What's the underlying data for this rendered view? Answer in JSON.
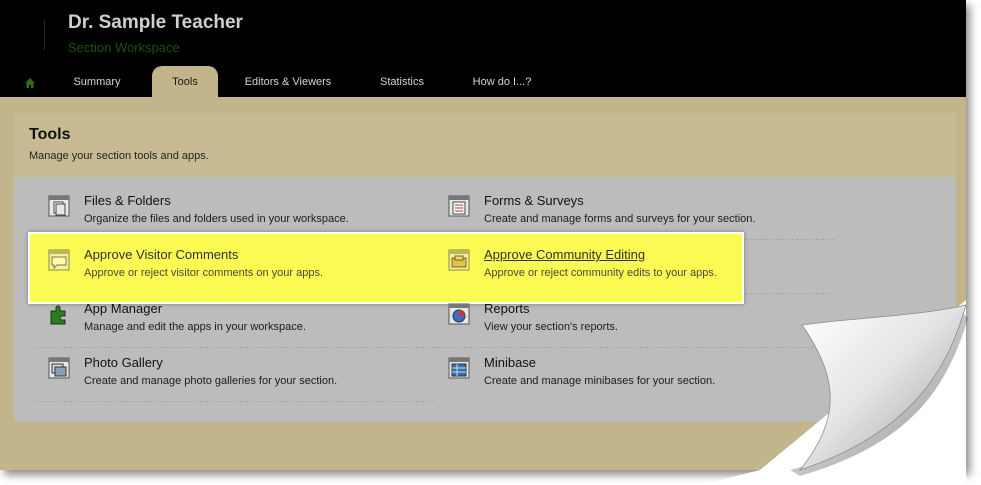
{
  "header": {
    "user_name": "Dr. Sample Teacher",
    "workspace": "Section Workspace",
    "tabs": [
      {
        "label": "Summary"
      },
      {
        "label": "Tools"
      },
      {
        "label": "Editors & Viewers"
      },
      {
        "label": "Statistics"
      },
      {
        "label": "How do I...?"
      }
    ],
    "active_tab": "Tools"
  },
  "panel": {
    "title": "Tools",
    "subtitle": "Manage your section tools and apps."
  },
  "tools": {
    "left": [
      {
        "title": "Files & Folders",
        "desc": "Organize the files and folders used in your workspace.",
        "icon": "files-folders-icon"
      },
      {
        "title": "Approve Visitor Comments",
        "desc": "Approve or reject visitor comments on your apps.",
        "icon": "comments-icon"
      },
      {
        "title": "App Manager",
        "desc": "Manage and edit the apps in your workspace.",
        "icon": "puzzle-icon"
      },
      {
        "title": "Photo Gallery",
        "desc": "Create and manage photo galleries for your section.",
        "icon": "photo-gallery-icon"
      }
    ],
    "right": [
      {
        "title": "Forms & Surveys",
        "desc": "Create and manage forms and surveys for your section.",
        "icon": "forms-icon"
      },
      {
        "title": "Approve Community Editing",
        "desc": "Approve or reject community edits to your apps.",
        "icon": "community-editing-icon"
      },
      {
        "title": "Reports",
        "desc": "View your section's reports.",
        "icon": "reports-icon"
      },
      {
        "title": "Minibase",
        "desc": "Create and manage minibases for your section.",
        "icon": "minibase-icon"
      }
    ]
  },
  "colors": {
    "header_bg": "#000000",
    "page_bg": "#c2b48b",
    "panel_bg": "#bcbcbc",
    "highlight": "#fbfb54",
    "workspace_text": "#1f4f12"
  }
}
